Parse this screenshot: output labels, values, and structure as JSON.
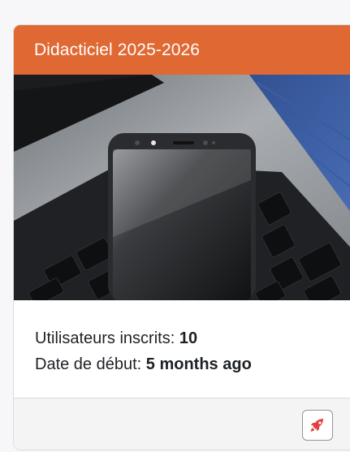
{
  "card": {
    "title": "Didacticiel 2025-2026",
    "header_color": "#e06832",
    "image_alt": "Smartphone resting on a laptop keyboard",
    "enrolled": {
      "label": "Utilisateurs inscrits:",
      "value": "10"
    },
    "start_date": {
      "label": "Date de début:",
      "value": "5 months ago"
    },
    "action": {
      "icon": "rocket-icon",
      "accent": "#e2413d"
    }
  }
}
